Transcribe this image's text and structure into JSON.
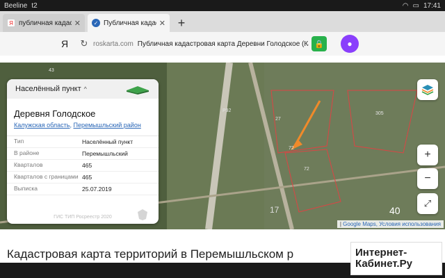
{
  "status_bar": {
    "carrier": "Beeline",
    "carrier2": "t2",
    "time": "17:41"
  },
  "tabs": [
    {
      "label": "публичная кадаст",
      "favicon": "Я"
    },
    {
      "label": "Публичная кадас",
      "favicon": "✓"
    }
  ],
  "address_bar": {
    "brand": "Я",
    "domain": "roskarta.com",
    "page_title": "Публичная кадастровая карта Деревни Голодское (Калужская област"
  },
  "info_panel": {
    "header": "Населённый пункт",
    "title": "Деревня Голодское",
    "links": [
      "Калужская область",
      "Перемышльский район"
    ],
    "rows": [
      {
        "key": "Тип",
        "value": "Населённый пункт"
      },
      {
        "key": "В районе",
        "value": "Перемышльский"
      },
      {
        "key": "Кварталов",
        "value": "465"
      },
      {
        "key": "Кварталов с границами",
        "value": "465"
      },
      {
        "key": "Выписка",
        "value": "25.07.2019"
      }
    ],
    "footer": "ГИС ТИП Росреестр 2020"
  },
  "map": {
    "labels": [
      "43",
      "Р92",
      "72",
      "72",
      "305",
      "27",
      "40",
      "17"
    ],
    "attribution_prefix": "| ",
    "attribution_link": "Google Maps, Условия использования"
  },
  "headline": "Кадастровая карта территорий в Перемышльском р",
  "watermark": {
    "line1": "Интернет-",
    "line2": "Кабинет.Ру"
  },
  "colors": {
    "accent_green": "#28b14c",
    "mic_purple": "#8a3ffc",
    "map_bg": "#5b6a48"
  }
}
